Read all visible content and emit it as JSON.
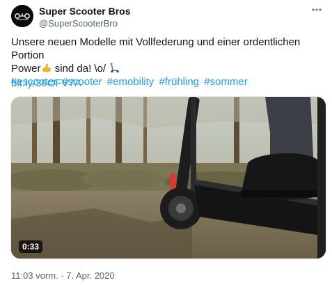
{
  "author": {
    "name": "Super Scooter Bros",
    "handle": "@SuperScooterBro"
  },
  "tweet": {
    "line1": "Unsere neuen Modelle mit Vollfederung und einer ordentlichen Portion",
    "line2_prefix": "Power",
    "line2_suffix": " sind da! \\o/ ",
    "link": "bit.ly/39OFV7A",
    "hashtags": [
      "#escooter",
      "#scooter",
      "#emobility",
      "#frühling",
      " #sommer"
    ]
  },
  "video": {
    "duration": "0:33"
  },
  "timestamp": "11:03 vorm. · 7. Apr. 2020",
  "icons": {
    "more": "more-options-icon",
    "muscle": "flexed-biceps-icon",
    "scooter": "kick-scooter-icon"
  }
}
